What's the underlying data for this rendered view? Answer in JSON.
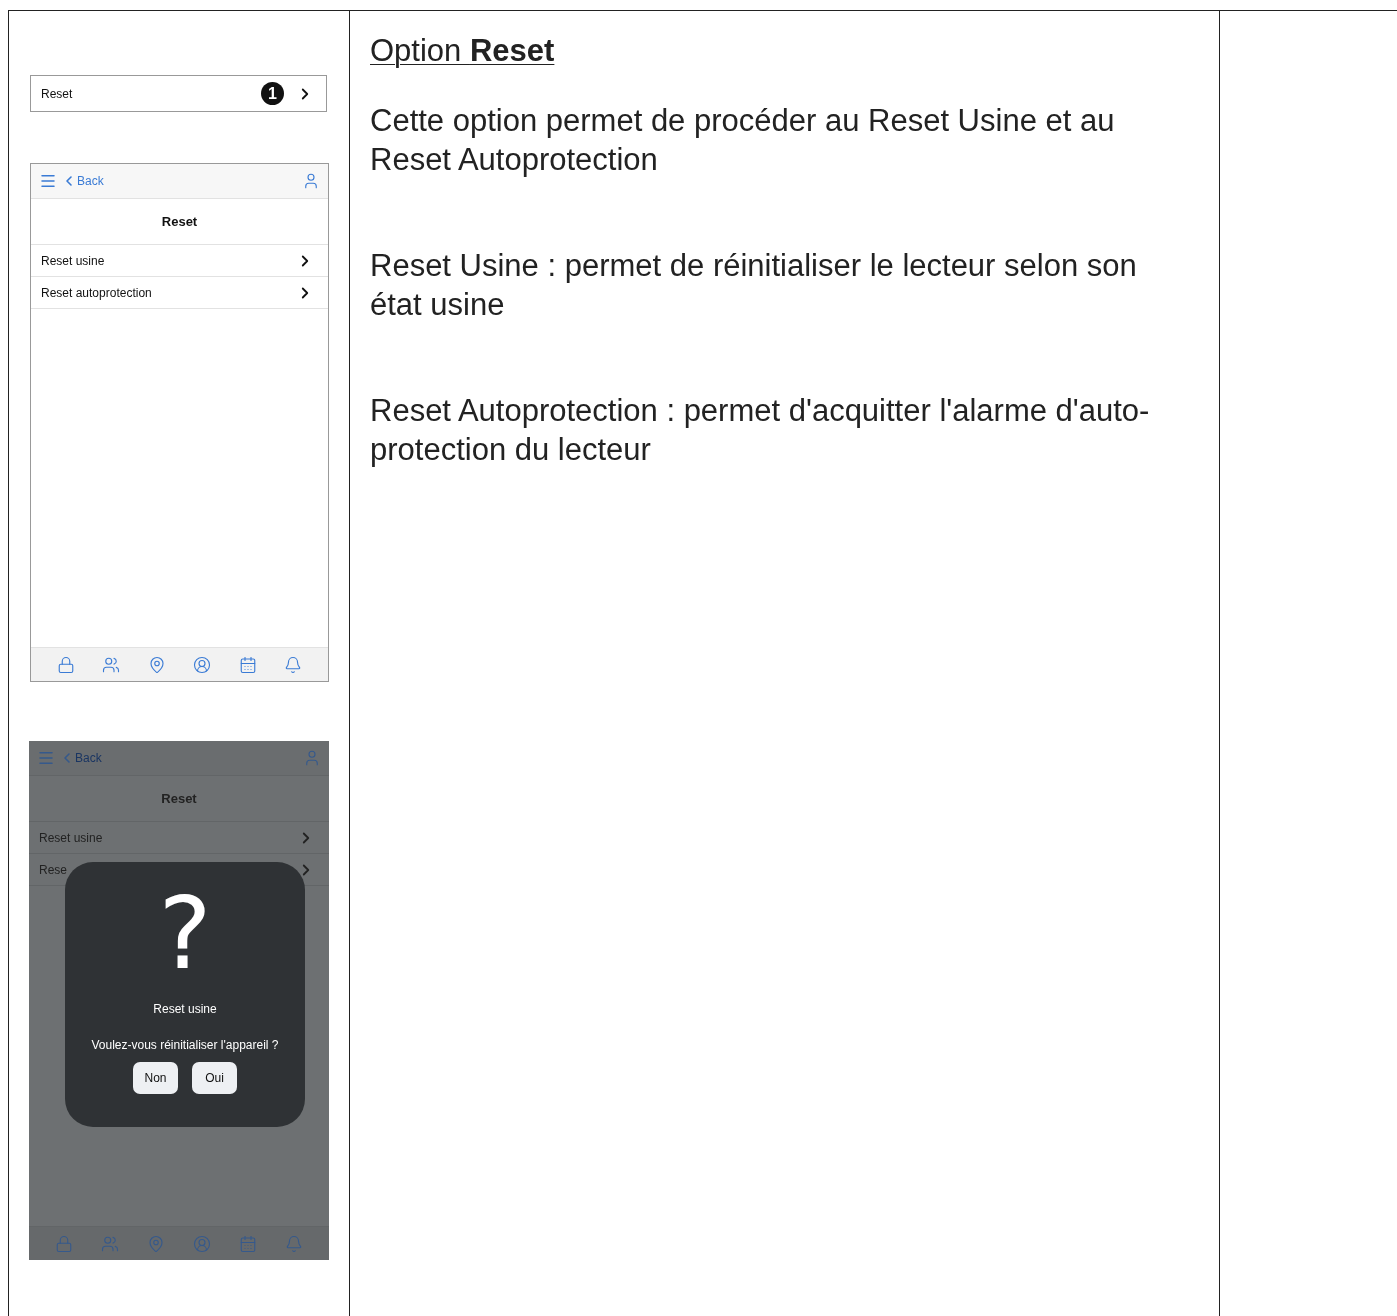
{
  "table": {
    "column_1": {
      "menu_row": {
        "label": "Reset",
        "badge": "1"
      },
      "screen": {
        "back": "Back",
        "title": "Reset",
        "dimmed": false,
        "items": [
          {
            "label": "Reset usine"
          },
          {
            "label": "Reset autoprotection"
          }
        ]
      },
      "dialog_screen": {
        "back": "Back",
        "title": "Reset",
        "dimmed": true,
        "items": [
          {
            "label": "Reset usine"
          },
          {
            "label": "Rese"
          }
        ],
        "dialog": {
          "symbol": "?",
          "title": "Reset usine",
          "message": "Voulez-vous réinitialiser l'appareil ?",
          "buttons": [
            "Non",
            "Oui"
          ]
        }
      }
    },
    "column_2": {
      "heading": "Option **Reset**",
      "paragraphs": [
        "Cette option permet de procéder au Reset Usine et au Reset Autoprotection",
        "Reset Usine : permet de réinitialiser le lecteur selon son état usine",
        "Reset Autoprotection : permet d'acquitter l'alarme d'auto-protection du lecteur"
      ]
    }
  }
}
